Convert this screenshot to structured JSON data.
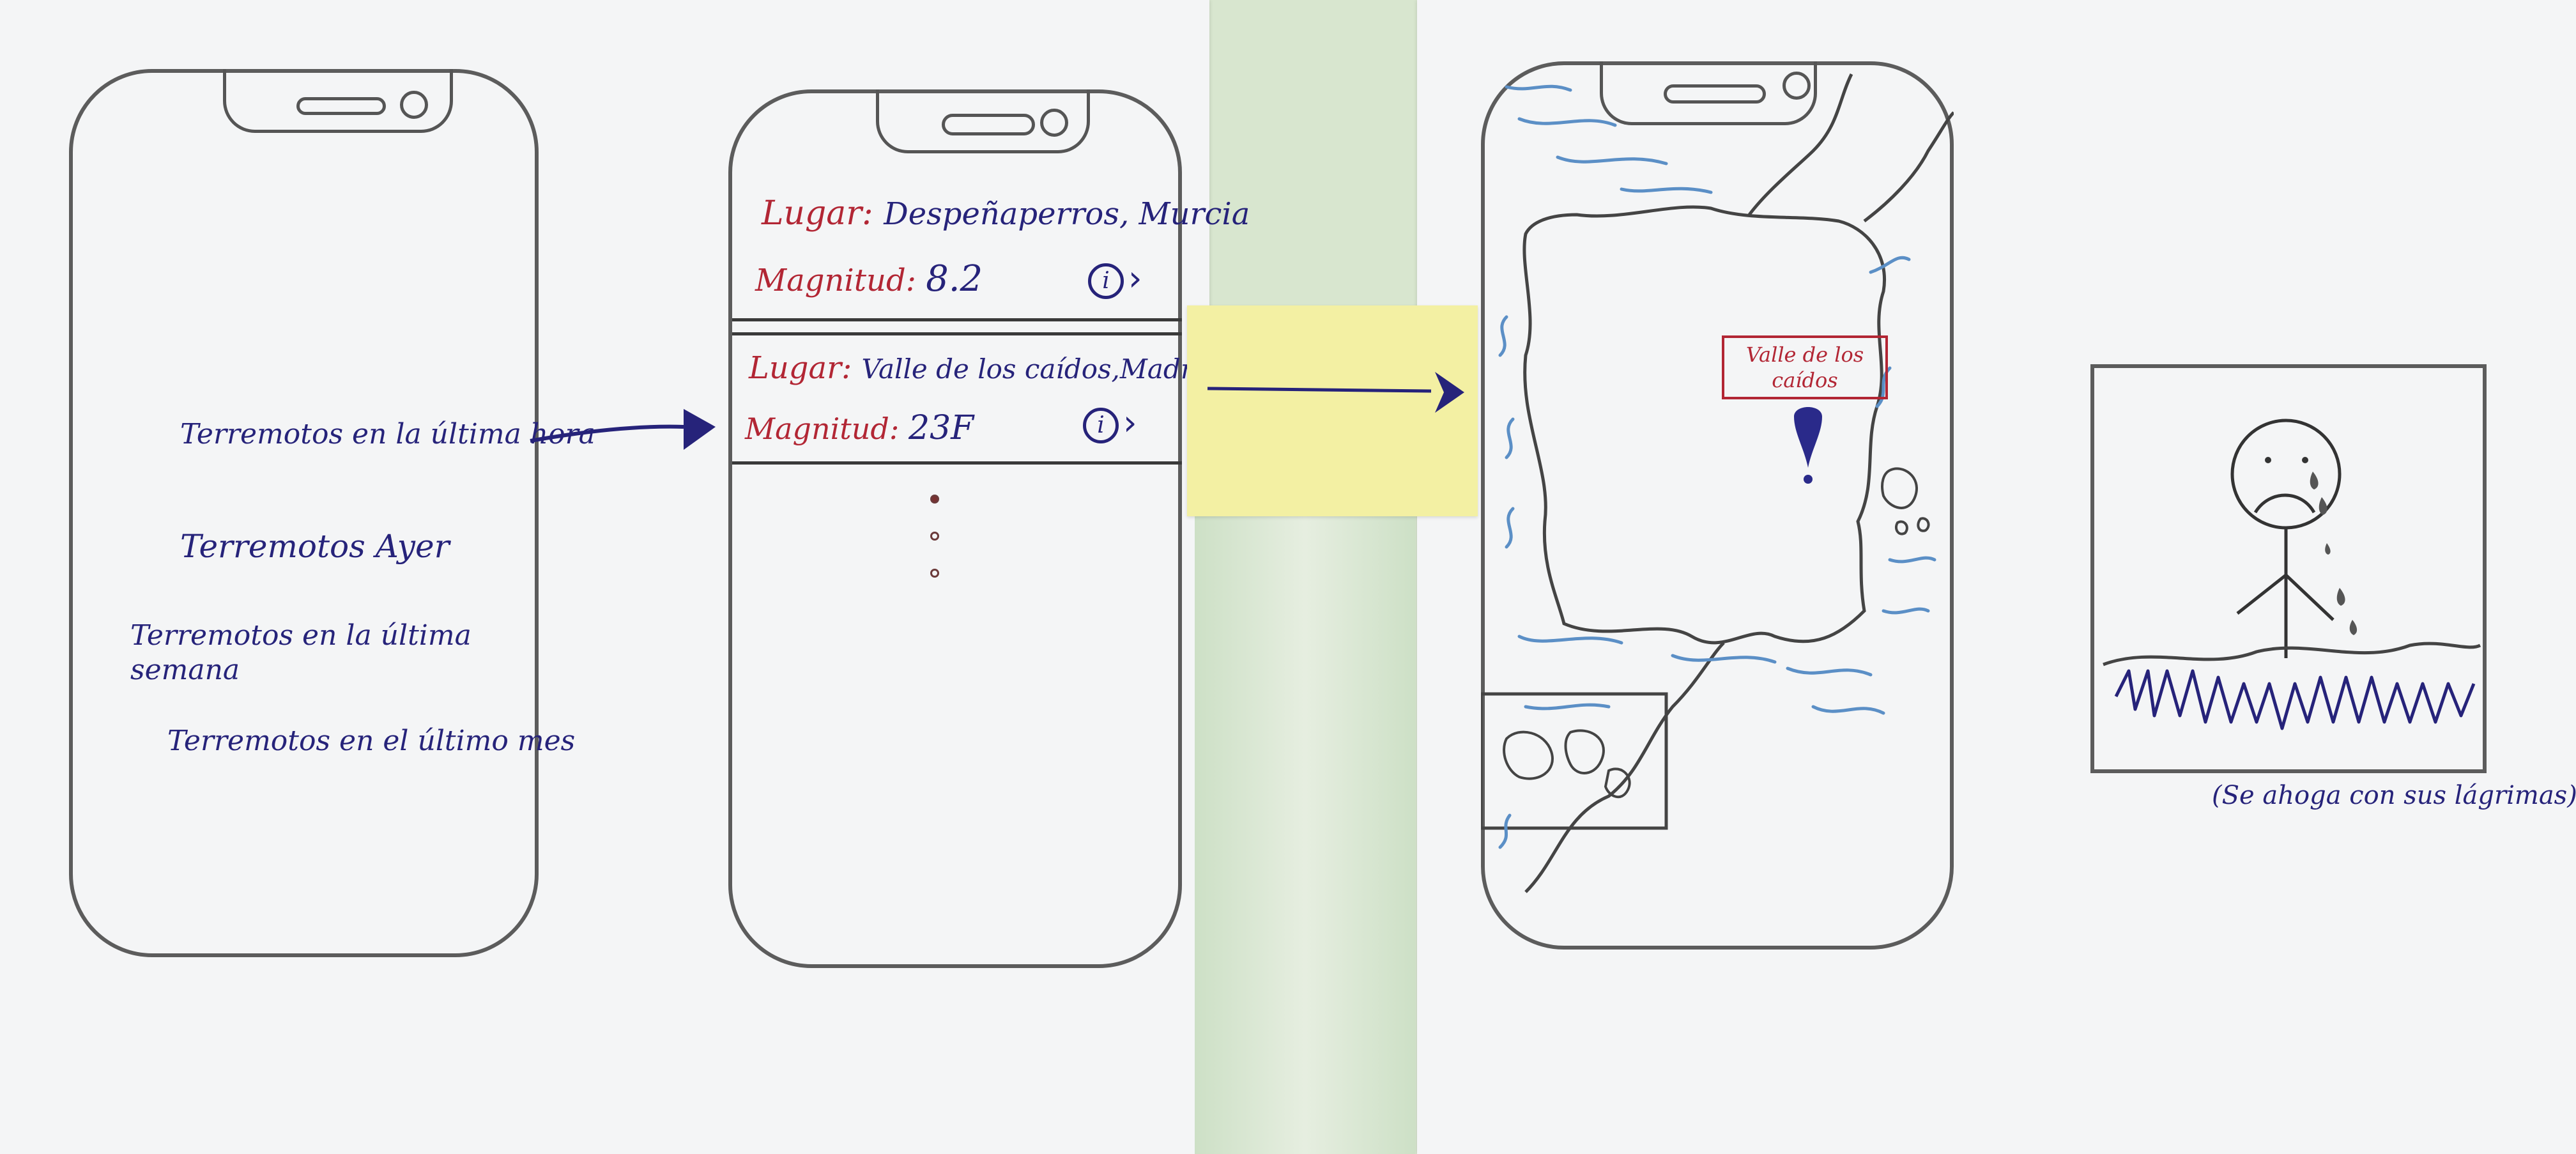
{
  "colors": {
    "background": "#d8e6cf",
    "paper": "#f4f5f6",
    "sticky_note": "#f3f0a3",
    "ink_navy": "#26237a",
    "ink_red": "#b22634",
    "pencil": "#5c5c5c",
    "water_blue": "#5b8fc6"
  },
  "screen1": {
    "menu": [
      "Terremotos en la última hora",
      "Terremotos Ayer",
      "Terremotos en la última semana",
      "Terremotos en el último mes"
    ]
  },
  "screen2": {
    "items": [
      {
        "place_label": "Lugar:",
        "place": "Despeñaperros, Murcia",
        "mag_label": "Magnitud:",
        "magnitude": "8.2",
        "info_icon": "info-circle-icon",
        "chevron_icon": "chevron-right-icon"
      },
      {
        "place_label": "Lugar:",
        "place": "Valle de los caídos,Madrid",
        "mag_label": "Magnitud:",
        "magnitude": "23F",
        "info_icon": "info-circle-icon",
        "chevron_icon": "chevron-right-icon"
      }
    ],
    "more_icon": "vertical-ellipsis-icon"
  },
  "screen3": {
    "marker_label": "Valle de los caídos",
    "marker_icon": "map-pin-icon"
  },
  "screen4": {
    "caption": "(Se ahoga con sus lágrimas)",
    "face_icon": "sad-face-icon"
  }
}
